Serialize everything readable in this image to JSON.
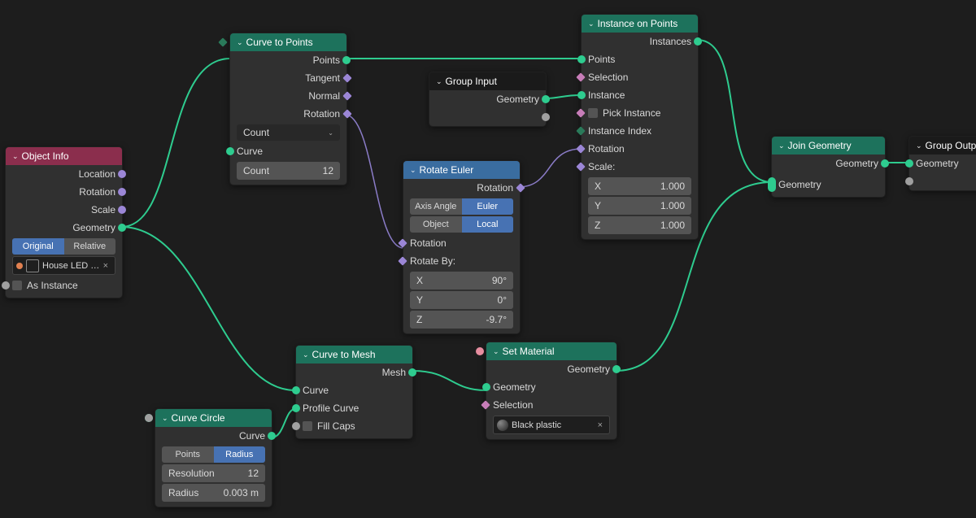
{
  "nodes": {
    "object_info": {
      "title": "Object Info",
      "out_location": "Location",
      "out_rotation": "Rotation",
      "out_scale": "Scale",
      "out_geometry": "Geometry",
      "mode_original": "Original",
      "mode_relative": "Relative",
      "object_name": "House LED …",
      "as_instance": "As Instance"
    },
    "curve_to_points": {
      "title": "Curve to Points",
      "out_points": "Points",
      "out_tangent": "Tangent",
      "out_normal": "Normal",
      "out_rotation": "Rotation",
      "mode": "Count",
      "in_curve": "Curve",
      "count_label": "Count",
      "count_value": "12"
    },
    "group_input": {
      "title": "Group Input",
      "out_geometry": "Geometry"
    },
    "rotate_euler": {
      "title": "Rotate Euler",
      "out_rotation": "Rotation",
      "type_axis": "Axis Angle",
      "type_euler": "Euler",
      "space_object": "Object",
      "space_local": "Local",
      "in_rotation": "Rotation",
      "rotate_by": "Rotate By:",
      "x_label": "X",
      "x_val": "90°",
      "y_label": "Y",
      "y_val": "0°",
      "z_label": "Z",
      "z_val": "-9.7°"
    },
    "instance_on_points": {
      "title": "Instance on Points",
      "out_instances": "Instances",
      "in_points": "Points",
      "in_selection": "Selection",
      "in_instance": "Instance",
      "pick_instance": "Pick Instance",
      "instance_index": "Instance Index",
      "in_rotation": "Rotation",
      "scale_label": "Scale:",
      "sx_label": "X",
      "sx_val": "1.000",
      "sy_label": "Y",
      "sy_val": "1.000",
      "sz_label": "Z",
      "sz_val": "1.000"
    },
    "curve_circle": {
      "title": "Curve Circle",
      "out_curve": "Curve",
      "mode_points": "Points",
      "mode_radius": "Radius",
      "resolution_label": "Resolution",
      "resolution_val": "12",
      "radius_label": "Radius",
      "radius_val": "0.003 m"
    },
    "curve_to_mesh": {
      "title": "Curve to Mesh",
      "out_mesh": "Mesh",
      "in_curve": "Curve",
      "in_profile": "Profile Curve",
      "fill_caps": "Fill Caps"
    },
    "set_material": {
      "title": "Set Material",
      "out_geometry": "Geometry",
      "in_geometry": "Geometry",
      "in_selection": "Selection",
      "material_name": "Black plastic"
    },
    "join_geometry": {
      "title": "Join Geometry",
      "out_geometry": "Geometry",
      "in_geometry": "Geometry"
    },
    "group_output": {
      "title": "Group Outp",
      "in_geometry": "Geometry"
    }
  }
}
